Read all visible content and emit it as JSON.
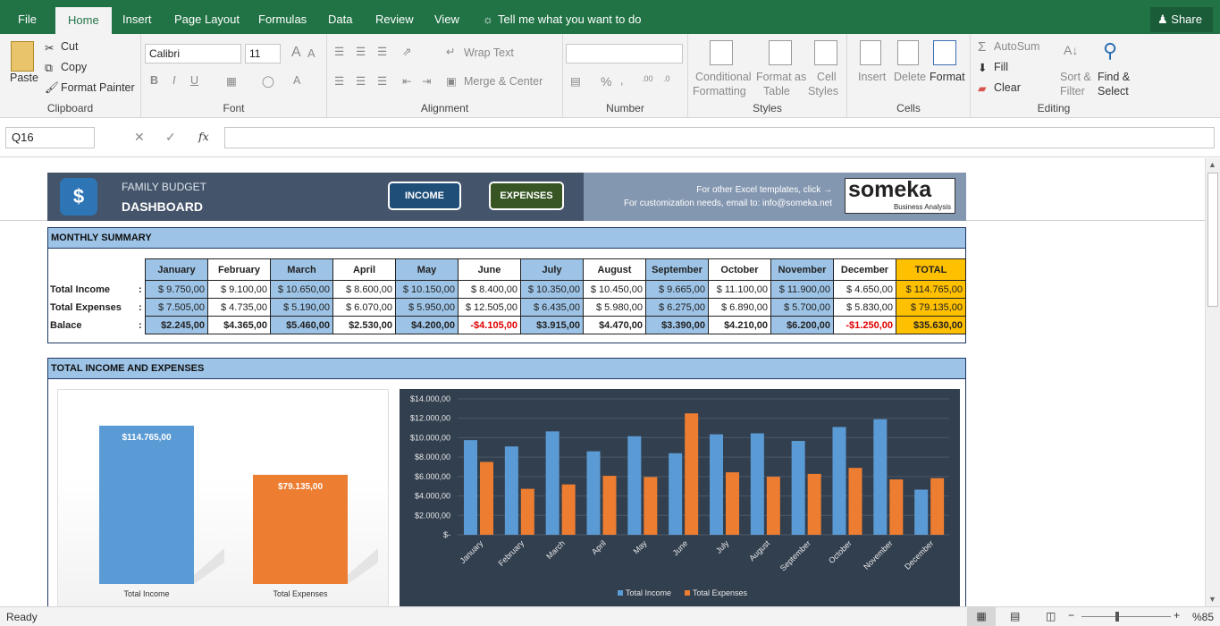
{
  "tabs": [
    "File",
    "Home",
    "Insert",
    "Page Layout",
    "Formulas",
    "Data",
    "Review",
    "View"
  ],
  "tell_me": "Tell me what you want to do",
  "share": "Share",
  "clipboard": {
    "paste": "Paste",
    "cut": "Cut",
    "copy": "Copy",
    "format_painter": "Format Painter",
    "label": "Clipboard"
  },
  "font": {
    "name": "Calibri",
    "size": "11",
    "label": "Font"
  },
  "alignment": {
    "wrap": "Wrap Text",
    "merge": "Merge & Center",
    "label": "Alignment"
  },
  "number": {
    "label": "Number",
    "percent": "%"
  },
  "styles": {
    "cond1": "Conditional",
    "cond2": "Formatting",
    "fmt1": "Format as",
    "fmt2": "Table",
    "cell1": "Cell",
    "cell2": "Styles",
    "label": "Styles"
  },
  "cells": {
    "insert": "Insert",
    "delete": "Delete",
    "format": "Format",
    "label": "Cells"
  },
  "editing": {
    "autosum": "AutoSum",
    "fill": "Fill",
    "clear": "Clear",
    "sort1": "Sort &",
    "sort2": "Filter",
    "find1": "Find &",
    "find2": "Select",
    "label": "Editing"
  },
  "namebox": "Q16",
  "fx": "fx",
  "header": {
    "family": "FAMILY BUDGET",
    "dashboard": "DASHBOARD",
    "income_btn": "INCOME",
    "expenses_btn": "EXPENSES",
    "line1": "For other Excel templates, click →",
    "line2": "For customization needs, email to: info@someka.net",
    "logo": "someka",
    "logo_sub": "Business Analysis"
  },
  "monthly_title": "MONTHLY SUMMARY",
  "months": [
    "January",
    "February",
    "March",
    "April",
    "May",
    "June",
    "July",
    "August",
    "September",
    "October",
    "November",
    "December",
    "TOTAL"
  ],
  "rows": [
    {
      "label": "Total Income",
      "vals": [
        "$  9.750,00",
        "$  9.100,00",
        "$ 10.650,00",
        "$  8.600,00",
        "$ 10.150,00",
        "$  8.400,00",
        "$ 10.350,00",
        "$ 10.450,00",
        "$  9.665,00",
        "$ 11.100,00",
        "$ 11.900,00",
        "$  4.650,00",
        "$  114.765,00"
      ]
    },
    {
      "label": "Total Expenses",
      "vals": [
        "$  7.505,00",
        "$  4.735,00",
        "$  5.190,00",
        "$  6.070,00",
        "$  5.950,00",
        "$ 12.505,00",
        "$  6.435,00",
        "$  5.980,00",
        "$  6.275,00",
        "$  6.890,00",
        "$  5.700,00",
        "$  5.830,00",
        "$    79.135,00"
      ]
    },
    {
      "label": "Balace",
      "vals": [
        "$2.245,00",
        "$4.365,00",
        "$5.460,00",
        "$2.530,00",
        "$4.200,00",
        "-$4.105,00",
        "$3.915,00",
        "$4.470,00",
        "$3.390,00",
        "$4.210,00",
        "$6.200,00",
        "-$1.250,00",
        "$35.630,00"
      ]
    }
  ],
  "colon": ":",
  "chart_title_bar": "TOTAL INCOME AND EXPENSES",
  "chart_data": [
    {
      "type": "bar",
      "categories": [
        "Total Income",
        "Total Expenses"
      ],
      "values": [
        114765,
        79135
      ],
      "data_labels": [
        "$114.765,00",
        "$79.135,00"
      ],
      "colors": [
        "#5b9bd5",
        "#ed7d31"
      ]
    },
    {
      "type": "bar",
      "categories": [
        "January",
        "February",
        "March",
        "April",
        "May",
        "June",
        "July",
        "August",
        "September",
        "October",
        "November",
        "December"
      ],
      "series": [
        {
          "name": "Total Income",
          "values": [
            9750,
            9100,
            10650,
            8600,
            10150,
            8400,
            10350,
            10450,
            9665,
            11100,
            11900,
            4650
          ],
          "color": "#5b9bd5"
        },
        {
          "name": "Total Expenses",
          "values": [
            7505,
            4735,
            5190,
            6070,
            5950,
            12505,
            6435,
            5980,
            6275,
            6890,
            5700,
            5830
          ],
          "color": "#ed7d31"
        }
      ],
      "ylim": [
        0,
        14000
      ],
      "yticks": [
        "$-",
        "$2.000,00",
        "$4.000,00",
        "$6.000,00",
        "$8.000,00",
        "$10.000,00",
        "$12.000,00",
        "$14.000,00"
      ],
      "legend": "bottom"
    }
  ],
  "status": {
    "ready": "Ready",
    "zoom": "%85"
  }
}
